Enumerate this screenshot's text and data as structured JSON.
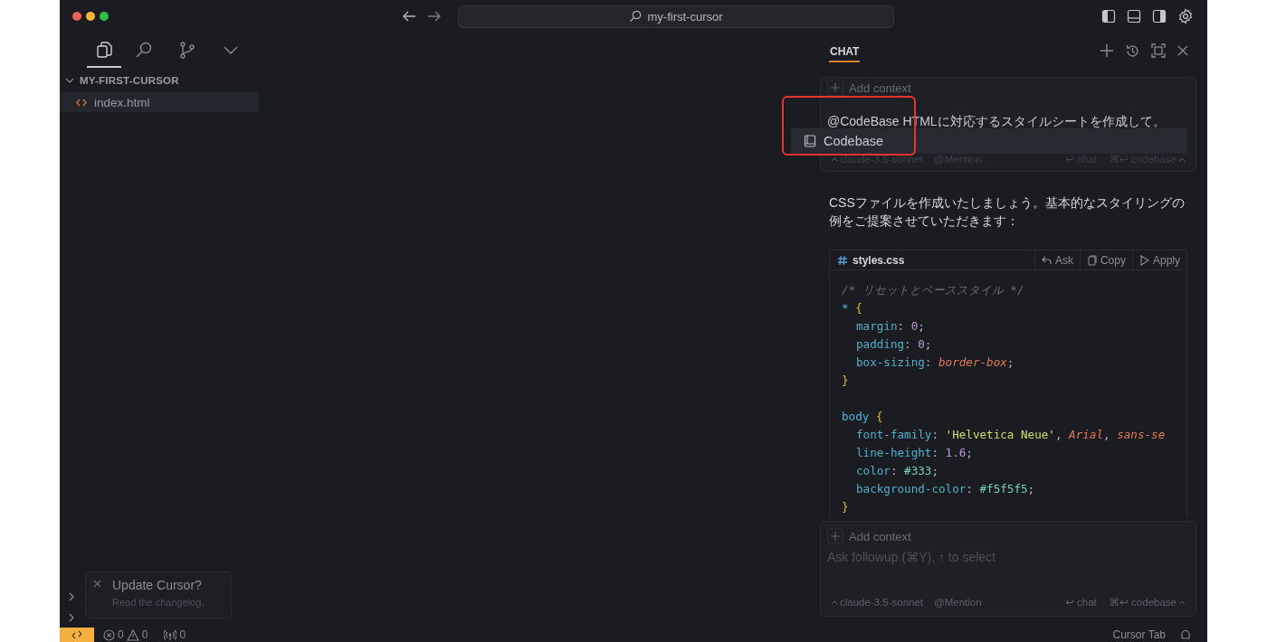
{
  "window": {
    "title": "my-first-cursor"
  },
  "activity_tabs": [
    {
      "kind": "files",
      "selected": true
    },
    {
      "kind": "search",
      "selected": false
    },
    {
      "kind": "branch",
      "selected": false
    },
    {
      "kind": "more",
      "selected": false
    }
  ],
  "explorer": {
    "title": "MY-FIRST-CURSOR",
    "expanded": true,
    "files": [
      {
        "name": "index.html",
        "selected": true
      }
    ]
  },
  "sections": [
    {
      "expanded": false
    },
    {
      "expanded": false
    }
  ],
  "notification": {
    "title": "Update Cursor?",
    "message": "Read the changelog."
  },
  "chat": {
    "tabs": [
      {
        "label": "CHAT",
        "selected": true
      }
    ],
    "user_message": {
      "context_label": "Add context",
      "text": "@CodeBase HTMLに対応するスタイルシートを作成して。",
      "model": "claude-3.5-sonnet",
      "mention": "@Mention",
      "submit": "↩ chat",
      "codebase": "⌘↩ codebase"
    },
    "mention_menu": [
      {
        "label": "Codebase",
        "selected": true
      }
    ],
    "response": {
      "text": "CSSファイルを作成いたしましょう。基本的なスタイリングの例をご提案させていただきます：",
      "code_block": {
        "filename": "styles.css",
        "actions": [
          {
            "kind": "ask",
            "label": "Ask"
          },
          {
            "kind": "copy",
            "label": "Copy"
          },
          {
            "kind": "apply",
            "label": "Apply"
          }
        ],
        "lines": [
          {
            "kind": "code",
            "tokens": [
              {
                "text": "/* リセットとベーススタイル */",
                "kind": "comment"
              }
            ]
          },
          {
            "kind": "code",
            "tokens": [
              {
                "text": "*",
                "kind": "selector"
              },
              {
                "text": "{",
                "kind": "brace"
              }
            ],
            "children": [
              {
                "kind": "code",
                "tokens": [
                  {
                    "text": "margin",
                    "kind": "property"
                  },
                  {
                    "text": ": ",
                    "kind": "punct"
                  },
                  {
                    "text": "0",
                    "kind": "number"
                  },
                  {
                    "text": ";",
                    "kind": "punct"
                  }
                ]
              },
              {
                "kind": "code",
                "tokens": [
                  {
                    "text": "padding",
                    "kind": "property"
                  },
                  {
                    "text": ": ",
                    "kind": "punct"
                  },
                  {
                    "text": "0",
                    "kind": "number"
                  },
                  {
                    "text": ";",
                    "kind": "punct"
                  }
                ]
              },
              {
                "kind": "code",
                "tokens": [
                  {
                    "text": "box-sizing",
                    "kind": "property"
                  },
                  {
                    "text": ": ",
                    "kind": "punct"
                  },
                  {
                    "text": "border-box",
                    "kind": "keyword"
                  },
                  {
                    "text": ";",
                    "kind": "punct"
                  }
                ]
              }
            ]
          },
          {
            "kind": "code",
            "tokens": [
              {
                "text": "}",
                "kind": "brace"
              }
            ]
          },
          {
            "kind": "blank"
          },
          {
            "kind": "code",
            "tokens": [
              {
                "text": "body",
                "kind": "selector"
              },
              {
                "text": "{",
                "kind": "brace"
              }
            ],
            "children": [
              {
                "kind": "code",
                "tokens": [
                  {
                    "text": "font-family",
                    "kind": "property"
                  },
                  {
                    "text": ": ",
                    "kind": "punct"
                  },
                  {
                    "text": "'Helvetica Neue'",
                    "kind": "string"
                  },
                  {
                    "text": ", ",
                    "kind": "punct"
                  },
                  {
                    "text": "Arial",
                    "kind": "keyword"
                  },
                  {
                    "text": ", ",
                    "kind": "punct"
                  },
                  {
                    "text": "sans-se",
                    "kind": "keyword"
                  }
                ]
              },
              {
                "kind": "code",
                "tokens": [
                  {
                    "text": "line-height",
                    "kind": "property"
                  },
                  {
                    "text": ": ",
                    "kind": "punct"
                  },
                  {
                    "text": "1.6",
                    "kind": "number"
                  },
                  {
                    "text": ";",
                    "kind": "punct"
                  }
                ]
              },
              {
                "kind": "code",
                "tokens": [
                  {
                    "text": "color",
                    "kind": "property"
                  },
                  {
                    "text": ": ",
                    "kind": "punct"
                  },
                  {
                    "text": "#333",
                    "kind": "hex"
                  },
                  {
                    "text": ";",
                    "kind": "punct"
                  }
                ]
              },
              {
                "kind": "code",
                "tokens": [
                  {
                    "text": "background-color",
                    "kind": "property"
                  },
                  {
                    "text": ": ",
                    "kind": "punct"
                  },
                  {
                    "text": "#f5f5f5",
                    "kind": "hex"
                  },
                  {
                    "text": ";",
                    "kind": "punct"
                  }
                ]
              }
            ]
          },
          {
            "kind": "code",
            "tokens": [
              {
                "text": "}",
                "kind": "brace"
              }
            ]
          }
        ]
      }
    },
    "input": {
      "context_label": "Add context",
      "placeholder": "Ask followup (⌘Y), ↑ to select",
      "model": "claude-3.5-sonnet",
      "mention": "@Mention",
      "submit": "↩ chat",
      "codebase": "⌘↩ codebase"
    }
  },
  "status_bar": {
    "errors": "0",
    "warnings": "0",
    "ports": "0",
    "right": "Cursor Tab"
  }
}
